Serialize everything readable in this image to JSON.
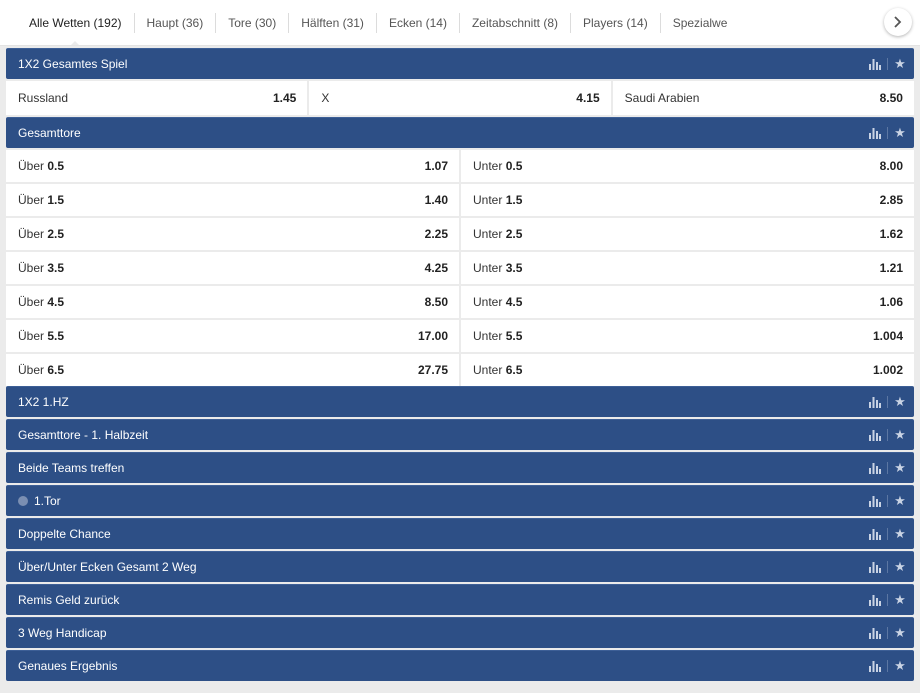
{
  "tabs": [
    {
      "label": "Alle Wetten (192)",
      "active": true
    },
    {
      "label": "Haupt (36)"
    },
    {
      "label": "Tore (30)"
    },
    {
      "label": "Hälften (31)"
    },
    {
      "label": "Ecken (14)"
    },
    {
      "label": "Zeitabschnitt (8)"
    },
    {
      "label": "Players (14)"
    },
    {
      "label": "Spezialwe"
    }
  ],
  "market_1x2": {
    "title": "1X2 Gesamtes Spiel",
    "outcomes": [
      {
        "label": "Russland",
        "odd": "1.45"
      },
      {
        "label": "X",
        "odd": "4.15"
      },
      {
        "label": "Saudi Arabien",
        "odd": "8.50"
      }
    ]
  },
  "market_total": {
    "title": "Gesamttore",
    "over_label": "Über",
    "under_label": "Unter",
    "lines": [
      {
        "line": "0.5",
        "over": "1.07",
        "under": "8.00"
      },
      {
        "line": "1.5",
        "over": "1.40",
        "under": "2.85"
      },
      {
        "line": "2.5",
        "over": "2.25",
        "under": "1.62"
      },
      {
        "line": "3.5",
        "over": "4.25",
        "under": "1.21"
      },
      {
        "line": "4.5",
        "over": "8.50",
        "under": "1.06"
      },
      {
        "line": "5.5",
        "over": "17.00",
        "under": "1.004"
      },
      {
        "line": "6.5",
        "over": "27.75",
        "under": "1.002"
      }
    ]
  },
  "collapsed_markets": [
    {
      "title": "1X2 1.HZ"
    },
    {
      "title": "Gesamttore - 1. Halbzeit"
    },
    {
      "title": "Beide Teams treffen"
    },
    {
      "title": "1.Tor"
    },
    {
      "title": "Doppelte Chance"
    },
    {
      "title": "Über/Unter Ecken Gesamt 2 Weg"
    },
    {
      "title": "Remis Geld zurück"
    },
    {
      "title": "3 Weg Handicap"
    },
    {
      "title": "Genaues Ergebnis"
    }
  ],
  "icons": {
    "stats": "bar-chart-icon",
    "favorite": "star-icon",
    "next": "chevron-right-icon",
    "info": "info-icon"
  },
  "colors": {
    "header_bg": "#2d4f86",
    "page_bg": "#ebebeb",
    "cell_bg": "#ffffff"
  }
}
